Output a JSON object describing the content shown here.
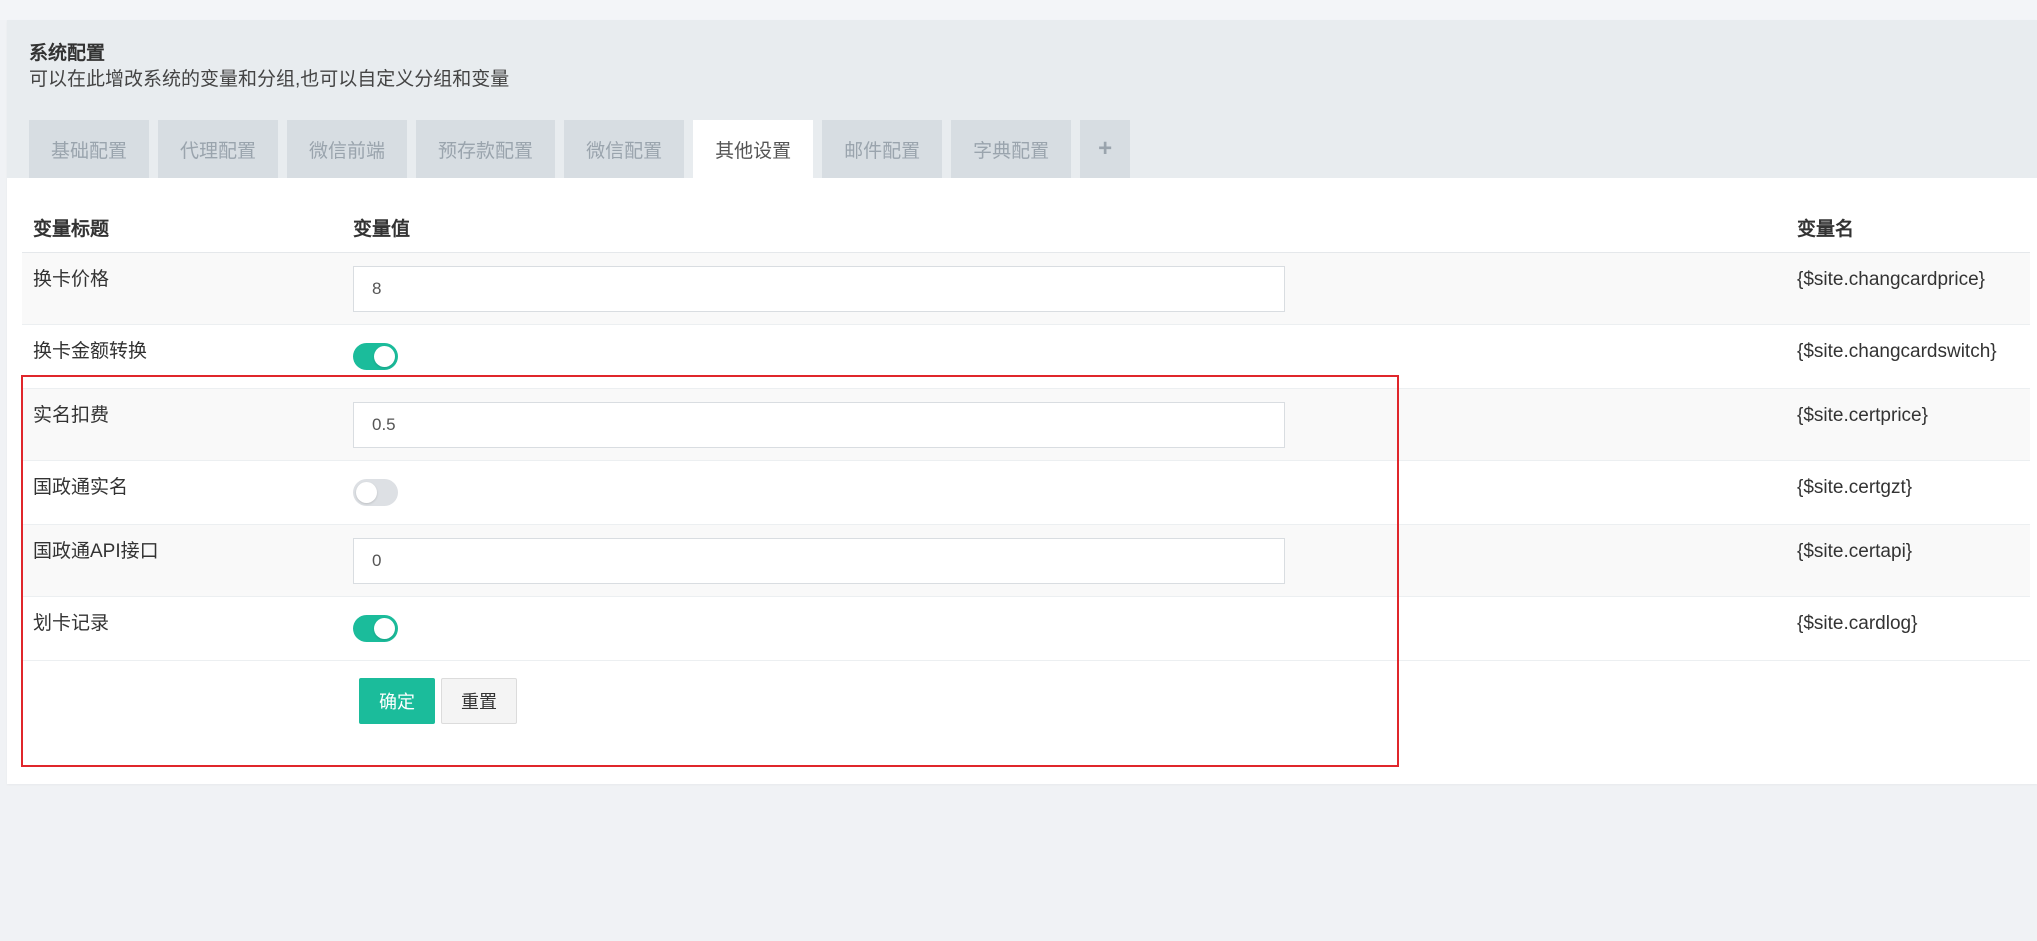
{
  "header": {
    "title": "系统配置",
    "subtitle": "可以在此增改系统的变量和分组,也可以自定义分组和变量"
  },
  "tabs": [
    {
      "label": "基础配置",
      "active": false
    },
    {
      "label": "代理配置",
      "active": false
    },
    {
      "label": "微信前端",
      "active": false
    },
    {
      "label": "预存款配置",
      "active": false
    },
    {
      "label": "微信配置",
      "active": false
    },
    {
      "label": "其他设置",
      "active": true
    },
    {
      "label": "邮件配置",
      "active": false
    },
    {
      "label": "字典配置",
      "active": false
    }
  ],
  "add_tab_label": "+",
  "table": {
    "headers": {
      "title": "变量标题",
      "value": "变量值",
      "name": "变量名"
    },
    "rows": [
      {
        "title": "换卡价格",
        "type": "input",
        "value": "8",
        "name": "{$site.changcardprice}"
      },
      {
        "title": "换卡金额转换",
        "type": "toggle",
        "on": true,
        "name": "{$site.changcardswitch}"
      },
      {
        "title": "实名扣费",
        "type": "input",
        "value": "0.5",
        "name": "{$site.certprice}"
      },
      {
        "title": "国政通实名",
        "type": "toggle",
        "on": false,
        "name": "{$site.certgzt}"
      },
      {
        "title": "国政通API接口",
        "type": "input",
        "value": "0",
        "name": "{$site.certapi}"
      },
      {
        "title": "划卡记录",
        "type": "toggle",
        "on": true,
        "name": "{$site.cardlog}"
      }
    ]
  },
  "actions": {
    "confirm_label": "确定",
    "reset_label": "重置"
  },
  "colors": {
    "accent": "#1bbc9b",
    "highlight": "#e0262b"
  }
}
